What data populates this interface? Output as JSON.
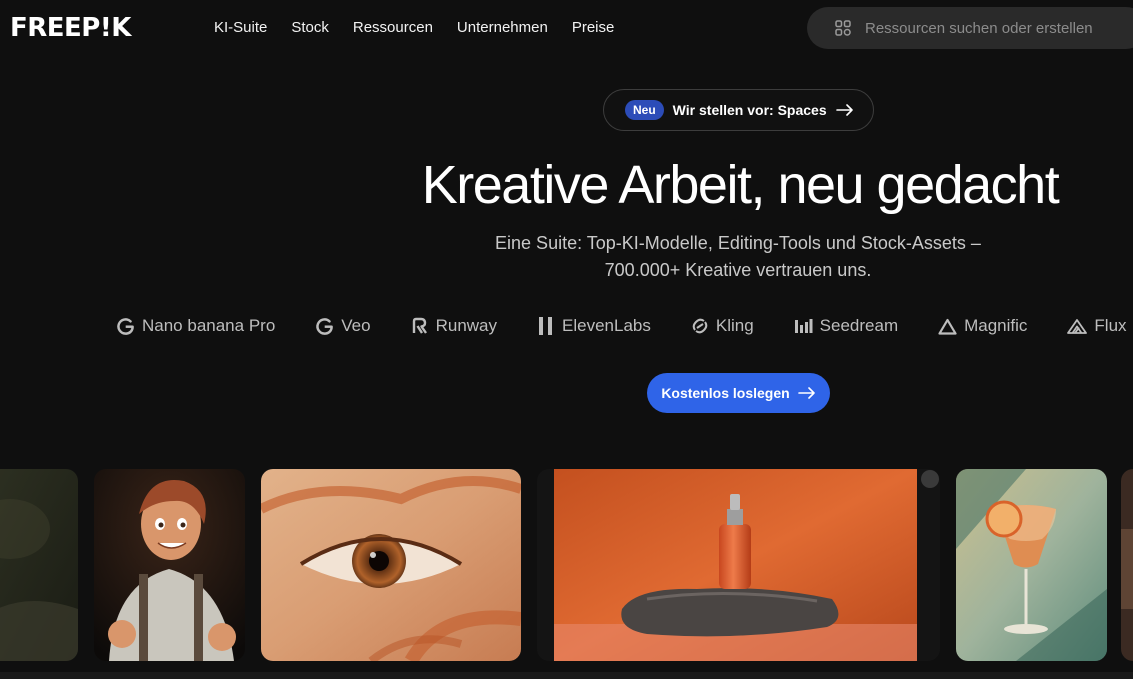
{
  "header": {
    "logo": "FREEP!K",
    "nav": [
      "KI-Suite",
      "Stock",
      "Ressourcen",
      "Unternehmen",
      "Preise"
    ],
    "search_placeholder": "Ressourcen suchen oder erstellen"
  },
  "announcement": {
    "badge": "Neu",
    "text": "Wir stellen vor: Spaces"
  },
  "hero": {
    "title": "Kreative Arbeit, neu gedacht",
    "subtitle_line1": "Eine Suite: Top-KI-Modelle, Editing-Tools und Stock-Assets –",
    "subtitle_line2": "700.000+ Kreative vertrauen uns."
  },
  "models": [
    {
      "name": "Nano banana Pro",
      "icon": "google-icon"
    },
    {
      "name": "Veo",
      "icon": "google-icon"
    },
    {
      "name": "Runway",
      "icon": "runway-icon"
    },
    {
      "name": "ElevenLabs",
      "icon": "elevenlabs-icon"
    },
    {
      "name": "Kling",
      "icon": "kling-icon"
    },
    {
      "name": "Seedream",
      "icon": "seedream-icon"
    },
    {
      "name": "Magnific",
      "icon": "magnific-icon"
    },
    {
      "name": "Flux",
      "icon": "flux-icon"
    }
  ],
  "cta": {
    "label": "Kostenlos loslegen"
  },
  "colors": {
    "background": "#0f0f0f",
    "accent": "#2f64e8",
    "badge": "#2c4cb8",
    "search_bg": "#2a2a2a"
  }
}
